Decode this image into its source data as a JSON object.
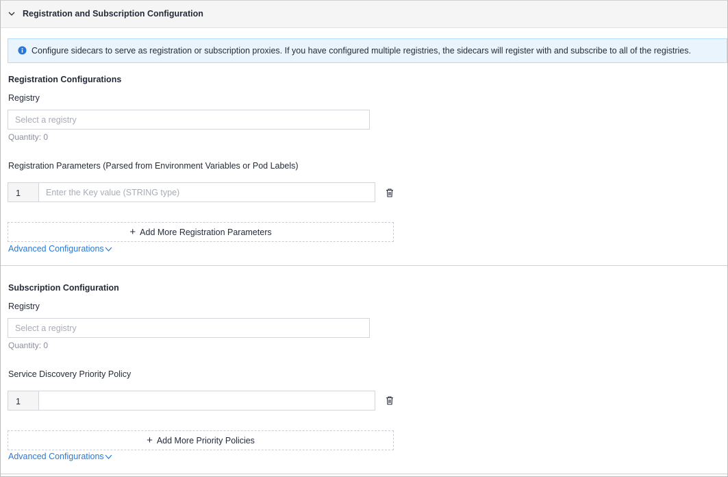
{
  "panel": {
    "title": "Registration and Subscription Configuration"
  },
  "info": {
    "text": "Configure sidecars to serve as registration or subscription proxies. If you have configured multiple registries, the sidecars will register with and subscribe to all of the registries."
  },
  "registration": {
    "section_title": "Registration Configurations",
    "registry_label": "Registry",
    "registry_placeholder": "Select a registry",
    "quantity": "Quantity: 0",
    "params_label": "Registration Parameters (Parsed from Environment Variables or Pod Labels)",
    "row_index": "1",
    "key_placeholder": "Enter the Key value (STRING type)",
    "add_more_label": "Add More Registration Parameters",
    "advanced_label": "Advanced Configurations"
  },
  "subscription": {
    "section_title": "Subscription Configuration",
    "registry_label": "Registry",
    "registry_placeholder": "Select a registry",
    "quantity": "Quantity: 0",
    "policy_label": "Service Discovery Priority Policy",
    "row_index": "1",
    "policy_value": "",
    "add_more_label": "Add More Priority Policies",
    "advanced_label": "Advanced Configurations"
  },
  "colors": {
    "link": "#2a78d6",
    "info_bg": "#eaf4fd",
    "info_icon": "#2a78d6"
  }
}
